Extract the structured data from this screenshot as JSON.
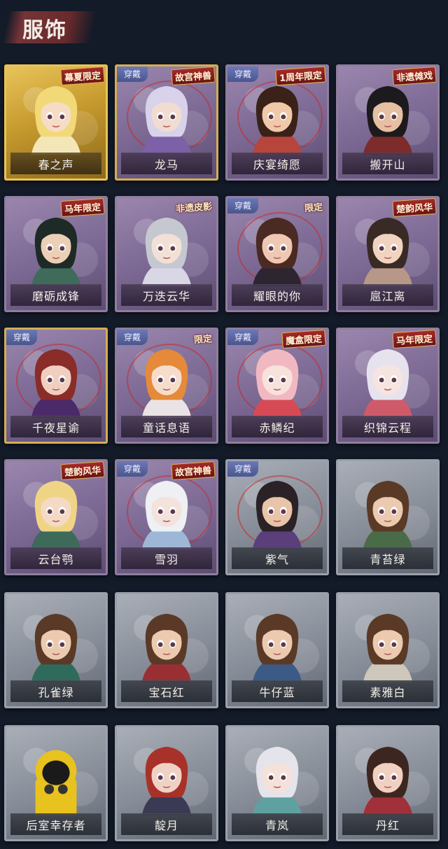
{
  "title": "服饰",
  "worn_label": "穿戴",
  "cards": [
    {
      "name": "春之声",
      "style": "gold",
      "tag": "幕夏限定",
      "worn": false,
      "hair": "#f1d978",
      "skin": "#f6dcc4",
      "cloth": "#f3e7b8"
    },
    {
      "name": "龙马",
      "style": "purple-gold",
      "tag": "故宫神兽",
      "worn": true,
      "hair": "#d8d2ea",
      "skin": "#f1dcd2",
      "cloth": "#7c61a8"
    },
    {
      "name": "庆宴绮愿",
      "style": "purple",
      "tag": "1周年限定",
      "worn": true,
      "hair": "#3a2218",
      "skin": "#f0c9a8",
      "cloth": "#b8453c"
    },
    {
      "name": "搬开山",
      "style": "purple",
      "tag": "非遗傩戏",
      "worn": false,
      "hair": "#1d1a1d",
      "skin": "#e5c0a2",
      "cloth": "#7d2b2b"
    },
    {
      "name": "磨砺成锋",
      "style": "purple",
      "tag": "马年限定",
      "worn": false,
      "hair": "#1e2a26",
      "skin": "#ecd0b6",
      "cloth": "#3f6b5b"
    },
    {
      "name": "万迭云华",
      "style": "purple",
      "tag": "非遗皮影",
      "worn": false,
      "hair": "#c5c8d0",
      "skin": "#f2e0d6",
      "cloth": "#d9d6e6"
    },
    {
      "name": "耀眼的你",
      "style": "purple",
      "tag": "限定",
      "worn": true,
      "hair": "#4a2a22",
      "skin": "#eec8b2",
      "cloth": "#2d2530"
    },
    {
      "name": "扈江离",
      "style": "purple",
      "tag": "楚韵风华",
      "worn": false,
      "hair": "#3a2a26",
      "skin": "#f0d4c0",
      "cloth": "#b79888"
    },
    {
      "name": "千夜星谕",
      "style": "purple-gold",
      "tag": "",
      "worn": true,
      "hair": "#8a2c28",
      "skin": "#f0cfc0",
      "cloth": "#4b2a6a"
    },
    {
      "name": "童话息语",
      "style": "purple",
      "tag": "限定",
      "worn": true,
      "hair": "#e48a3a",
      "skin": "#f6dccb",
      "cloth": "#eae3e6"
    },
    {
      "name": "赤鳞纪",
      "style": "purple",
      "tag": "魔盒限定",
      "worn": true,
      "hair": "#f2b8c2",
      "skin": "#f8e2dc",
      "cloth": "#d64a56"
    },
    {
      "name": "织锦云程",
      "style": "purple",
      "tag": "马年限定",
      "worn": false,
      "hair": "#e6e2ee",
      "skin": "#f6e4e0",
      "cloth": "#cf5b6a"
    },
    {
      "name": "云台鹗",
      "style": "purple",
      "tag": "楚韵风华",
      "worn": false,
      "hair": "#f0d486",
      "skin": "#f4dac4",
      "cloth": "#3e6a5a"
    },
    {
      "name": "雪羽",
      "style": "purple",
      "tag": "故宫神兽",
      "worn": true,
      "hair": "#eef0f4",
      "skin": "#f4e2dc",
      "cloth": "#9fb7d6"
    },
    {
      "name": "紫气",
      "style": "grey-gold",
      "tag": "",
      "worn": true,
      "hair": "#2a2226",
      "skin": "#e8c4a8",
      "cloth": "#5a3f7a"
    },
    {
      "name": "青苔绿",
      "style": "grey",
      "tag": "",
      "worn": false,
      "hair": "#5a3a26",
      "skin": "#eccab0",
      "cloth": "#4a6b48"
    },
    {
      "name": "孔雀绿",
      "style": "grey",
      "tag": "",
      "worn": false,
      "hair": "#5a3a26",
      "skin": "#eccab0",
      "cloth": "#2f6b5b"
    },
    {
      "name": "宝石红",
      "style": "grey",
      "tag": "",
      "worn": false,
      "hair": "#5a3a26",
      "skin": "#eccab0",
      "cloth": "#9a2f33"
    },
    {
      "name": "牛仔蓝",
      "style": "grey",
      "tag": "",
      "worn": false,
      "hair": "#5a3a26",
      "skin": "#eccab0",
      "cloth": "#3c5a86"
    },
    {
      "name": "素雅白",
      "style": "grey",
      "tag": "",
      "worn": false,
      "hair": "#5a3a26",
      "skin": "#eccab0",
      "cloth": "#cfc7bc"
    },
    {
      "name": "后室幸存者",
      "style": "grey",
      "tag": "",
      "worn": false,
      "hair": "#e8c21e",
      "skin": "#1a1a1a",
      "cloth": "#e8c21e"
    },
    {
      "name": "靛月",
      "style": "grey",
      "tag": "",
      "worn": false,
      "hair": "#a8322a",
      "skin": "#f0d2c4",
      "cloth": "#3a3a54"
    },
    {
      "name": "青岚",
      "style": "grey",
      "tag": "",
      "worn": false,
      "hair": "#e4e4ea",
      "skin": "#f4e2da",
      "cloth": "#5fa0a0"
    },
    {
      "name": "丹红",
      "style": "grey",
      "tag": "",
      "worn": false,
      "hair": "#3e2620",
      "skin": "#f0d0c0",
      "cloth": "#a0303a"
    }
  ]
}
